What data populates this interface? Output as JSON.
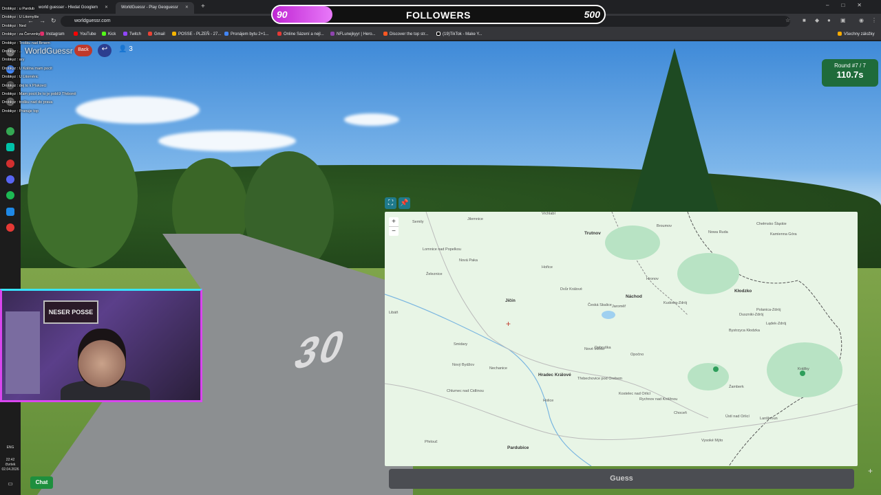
{
  "browser": {
    "tabs": [
      {
        "title": "world guesser - Hledat Googlem"
      },
      {
        "title": "WorldGuessr - Play Geoguessr"
      }
    ],
    "url": "worldguessr.com",
    "bookmarks": [
      "Instagram",
      "YouTube",
      "Kick",
      "Twitch",
      "Gmail",
      "POSSE - PLZEŇ - 27...",
      "Pronájem bytu 2+1...",
      "Online Sázení a nejl...",
      "NFLunejkyyr | Hero...",
      "Discover the top str...",
      "(19)TikTok - Make Y..."
    ],
    "bookmarks_all": "Všechny záložky"
  },
  "goal": {
    "current": "90",
    "title": "FOLLOWERS",
    "target": "500",
    "progress": 0.18
  },
  "chat_log": [
    "Drobkyz : u Pardub",
    "Drobkyz : U Litomyšle",
    "Drobkyz : Ned",
    "Drobkyz : za Červenky",
    "Drobkyz : Trošku nad Brnem",
    "Drobkyz : ...",
    "Drobkyz : ary",
    "Drobkyz : U Kolína mam pocit",
    "Drobkyz : U Litoměric",
    "Drobkyz : dej to k Pískovci",
    "Drobkyz : Mam pocit že to je poblíž Třeboně",
    "Drobkyz : trošku nad do prava",
    "Drobkyz : Pranuje top"
  ],
  "game": {
    "logo": "WorldGuessr",
    "back_label": "Back",
    "players": "3",
    "round_label": "Round #7 / 7",
    "timer": "110.7s",
    "guess_label": "Guess",
    "chat_label": "Chat"
  },
  "road_marking": "30",
  "webcam": {
    "poster": "NESER POSSE"
  },
  "taskbar": {
    "lang": "ENG",
    "time": "22:42",
    "day": "čtvrtek",
    "date": "02.04.2026"
  },
  "map": {
    "towns": [
      {
        "name": "Semily"
      },
      {
        "name": "Jilemnice"
      },
      {
        "name": "Vrchlabí"
      },
      {
        "name": "Trutnov"
      },
      {
        "name": "Lomnice nad Popelkou"
      },
      {
        "name": "Nová Paka"
      },
      {
        "name": "Železnice"
      },
      {
        "name": "Jičín"
      },
      {
        "name": "Hořice"
      },
      {
        "name": "Dvůr Králové"
      },
      {
        "name": "Náchod"
      },
      {
        "name": "Jaroměř"
      },
      {
        "name": "Česká Skalice"
      },
      {
        "name": "Hronov"
      },
      {
        "name": "Broumov"
      },
      {
        "name": "Libáň"
      },
      {
        "name": "Smidary"
      },
      {
        "name": "Nový Bydžov"
      },
      {
        "name": "Nechanice"
      },
      {
        "name": "Hradec Králové"
      },
      {
        "name": "Opočno"
      },
      {
        "name": "Dobruška"
      },
      {
        "name": "Nové Město"
      },
      {
        "name": "Třebechovice pod Orebem"
      },
      {
        "name": "Chlumec nad Cidlinou"
      },
      {
        "name": "Kostelec nad Orlicí"
      },
      {
        "name": "Rychnov nad Kněžnou"
      },
      {
        "name": "Holice"
      },
      {
        "name": "Pardubice"
      },
      {
        "name": "Přelouč"
      },
      {
        "name": "Kłodzko"
      },
      {
        "name": "Nowa Ruda"
      },
      {
        "name": "Kudowa-Zdrój"
      },
      {
        "name": "Bystrzyca Kłodzka"
      },
      {
        "name": "Lądek-Zdrój"
      },
      {
        "name": "Králíky"
      },
      {
        "name": "Žamberk"
      },
      {
        "name": "Ústí nad Orlicí"
      },
      {
        "name": "Choceň"
      },
      {
        "name": "Vysoké Mýto"
      },
      {
        "name": "Lanškroun"
      },
      {
        "name": "Polanica-Zdrój"
      },
      {
        "name": "Duszniki-Zdrój"
      },
      {
        "name": "Chełmsko Śląskie"
      },
      {
        "name": "Kamienna Góra"
      }
    ]
  }
}
